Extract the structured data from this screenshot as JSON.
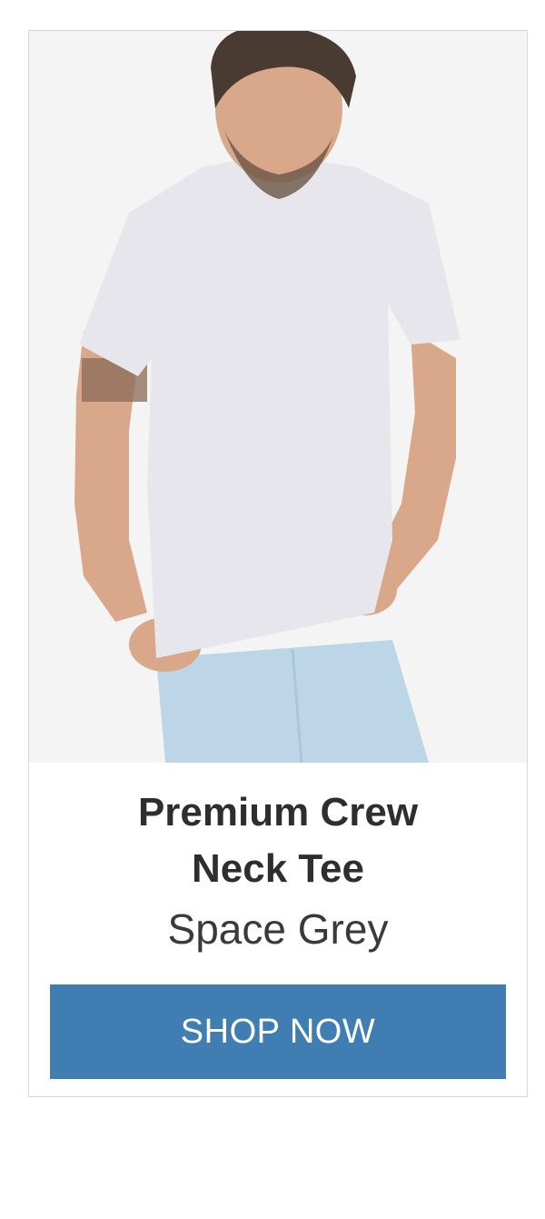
{
  "product": {
    "name_line1": "Premium Crew",
    "name_line2": "Neck Tee",
    "color_name": "Space Grey"
  },
  "cta": {
    "label": "SHOP NOW"
  },
  "colors": {
    "button": "#3f7db2",
    "text": "#2e2e2e",
    "border": "#d8d8d8",
    "photo_bg": "#f4f4f4"
  }
}
